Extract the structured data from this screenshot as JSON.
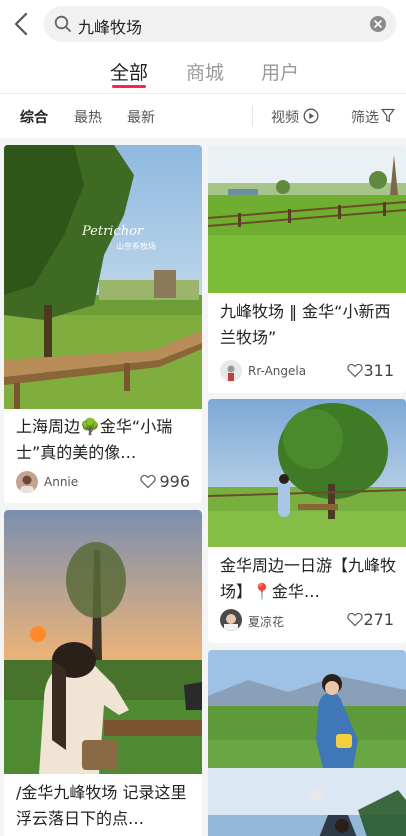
{
  "search": {
    "query": "九峰牧场"
  },
  "tabs": [
    {
      "label": "全部"
    },
    {
      "label": "商城"
    },
    {
      "label": "用户"
    }
  ],
  "filters": {
    "items": [
      "综合",
      "最热",
      "最新"
    ],
    "video": "视频",
    "screen": "筛选"
  },
  "cards": [
    {
      "title": "上海周边🌳金华“小瑞士”真的美的像…",
      "author": "Annie",
      "likes": "996",
      "overlay": [
        "Petrichor",
        "山奈系牧场"
      ]
    },
    {
      "title": "九峰牧场 ‖ 金华“小新西兰牧场”",
      "author": "Rr-Angela",
      "likes": "311"
    },
    {
      "title": "金华周边一日游【九峰牧场】📍金华…",
      "author": "夏凉花",
      "likes": "271"
    },
    {
      "title": "/金华九峰牧场 记录这里浮云落日下的点…"
    }
  ],
  "colors": {
    "accent": "#ff2442"
  }
}
